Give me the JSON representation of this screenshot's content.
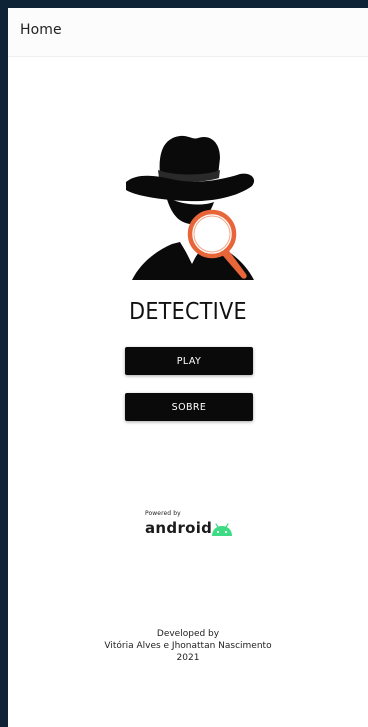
{
  "appbar": {
    "title": "Home"
  },
  "logo": {
    "icon": "detective-magnifier-icon"
  },
  "app_title": "DETECTIVE",
  "buttons": {
    "play": "PLAY",
    "sobre": "SOBRE"
  },
  "powered": {
    "caption": "Powered by",
    "brand": "android",
    "icon": "android-robot-icon"
  },
  "credits": {
    "line1": "Developed by",
    "line2": "Vitória Alves e Jhonattan Nascimento",
    "line3": "2021"
  },
  "colors": {
    "background": "#ffffff",
    "button": "#0a0a0a",
    "magnifier_accent": "#e8653a",
    "android_green": "#3ddc84",
    "outer_frame": "#0e2336"
  }
}
